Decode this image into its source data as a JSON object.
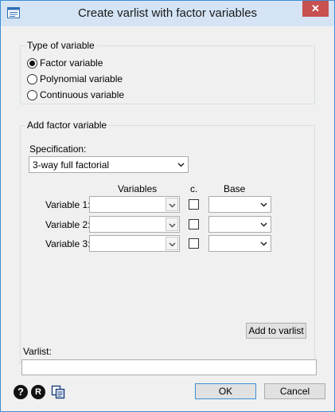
{
  "window": {
    "title": "Create varlist with factor variables",
    "close_label": "✕"
  },
  "type_group": {
    "label": "Type of variable",
    "options": [
      {
        "label": "Factor variable",
        "checked": true
      },
      {
        "label": "Polynomial variable",
        "checked": false
      },
      {
        "label": "Continuous variable",
        "checked": false
      }
    ]
  },
  "factor_group": {
    "label": "Add factor variable",
    "specification_label": "Specification:",
    "specification_value": "3-way full factorial",
    "col_variables": "Variables",
    "col_c": "c.",
    "col_base": "Base",
    "rows": [
      {
        "label": "Variable 1:",
        "value": "",
        "c_checked": false,
        "base": ""
      },
      {
        "label": "Variable 2:",
        "value": "",
        "c_checked": false,
        "base": ""
      },
      {
        "label": "Variable 3:",
        "value": "",
        "c_checked": false,
        "base": ""
      }
    ],
    "add_button": "Add to varlist"
  },
  "varlist": {
    "label": "Varlist:",
    "value": ""
  },
  "footer": {
    "ok": "OK",
    "cancel": "Cancel",
    "help_glyph": "?",
    "reset_glyph": "R"
  }
}
